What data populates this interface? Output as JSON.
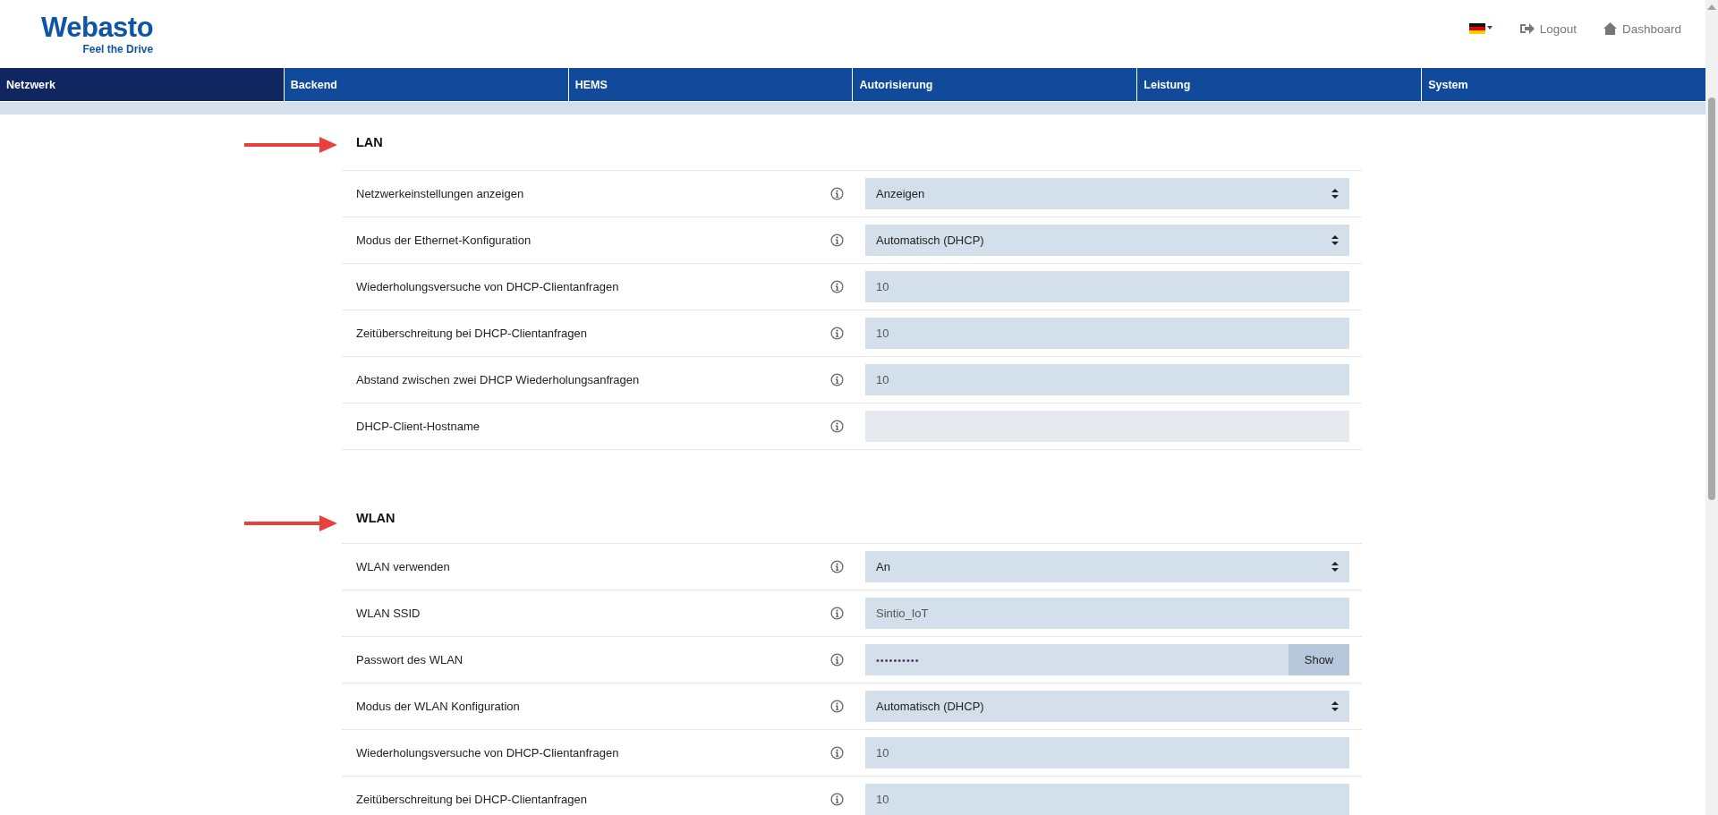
{
  "header": {
    "logo": {
      "name": "Webasto",
      "tagline": "Feel the Drive"
    },
    "links": [
      {
        "kind": "flag"
      },
      {
        "kind": "logout",
        "label": "Logout"
      },
      {
        "kind": "home",
        "label": "Dashboard"
      }
    ]
  },
  "tabs": [
    {
      "label": "Netzwerk",
      "selected": true
    },
    {
      "label": "Backend",
      "selected": false
    },
    {
      "label": "HEMS",
      "selected": false
    },
    {
      "label": "Autorisierung",
      "selected": false
    },
    {
      "label": "Leistung",
      "selected": false
    },
    {
      "label": "System",
      "selected": false
    }
  ],
  "sections": [
    {
      "title": "LAN",
      "rows": [
        {
          "label": "Netzwerkeinstellungen anzeigen",
          "kind": "select",
          "value": "Anzeigen",
          "disabled": false
        },
        {
          "label": "Modus der Ethernet-Konfiguration",
          "kind": "select",
          "value": "Automatisch (DHCP)",
          "disabled": false
        },
        {
          "label": "Wiederholungsversuche von DHCP-Clientanfragen",
          "kind": "text",
          "value": "10",
          "disabled": false
        },
        {
          "label": "Zeitüberschreitung bei DHCP-Clientanfragen",
          "kind": "text",
          "value": "10",
          "disabled": false
        },
        {
          "label": "Abstand zwischen zwei DHCP Wiederholungsanfragen",
          "kind": "text",
          "value": "10",
          "disabled": false
        },
        {
          "label": "DHCP-Client-Hostname",
          "kind": "text",
          "value": "",
          "disabled": true
        }
      ]
    },
    {
      "title": "WLAN",
      "rows": [
        {
          "label": "WLAN verwenden",
          "kind": "select",
          "value": "An",
          "disabled": false
        },
        {
          "label": "WLAN SSID",
          "kind": "text",
          "value": "Sintio_IoT",
          "disabled": false
        },
        {
          "label": "Passwort des WLAN",
          "kind": "password",
          "value": "••••••••••",
          "button": "Show",
          "disabled": false
        },
        {
          "label": "Modus der WLAN Konfiguration",
          "kind": "select",
          "value": "Automatisch (DHCP)",
          "disabled": false
        },
        {
          "label": "Wiederholungsversuche von DHCP-Clientanfragen",
          "kind": "text",
          "value": "10",
          "disabled": false
        },
        {
          "label": "Zeitüberschreitung bei DHCP-Clientanfragen",
          "kind": "text",
          "value": "10",
          "disabled": false
        }
      ]
    }
  ]
}
